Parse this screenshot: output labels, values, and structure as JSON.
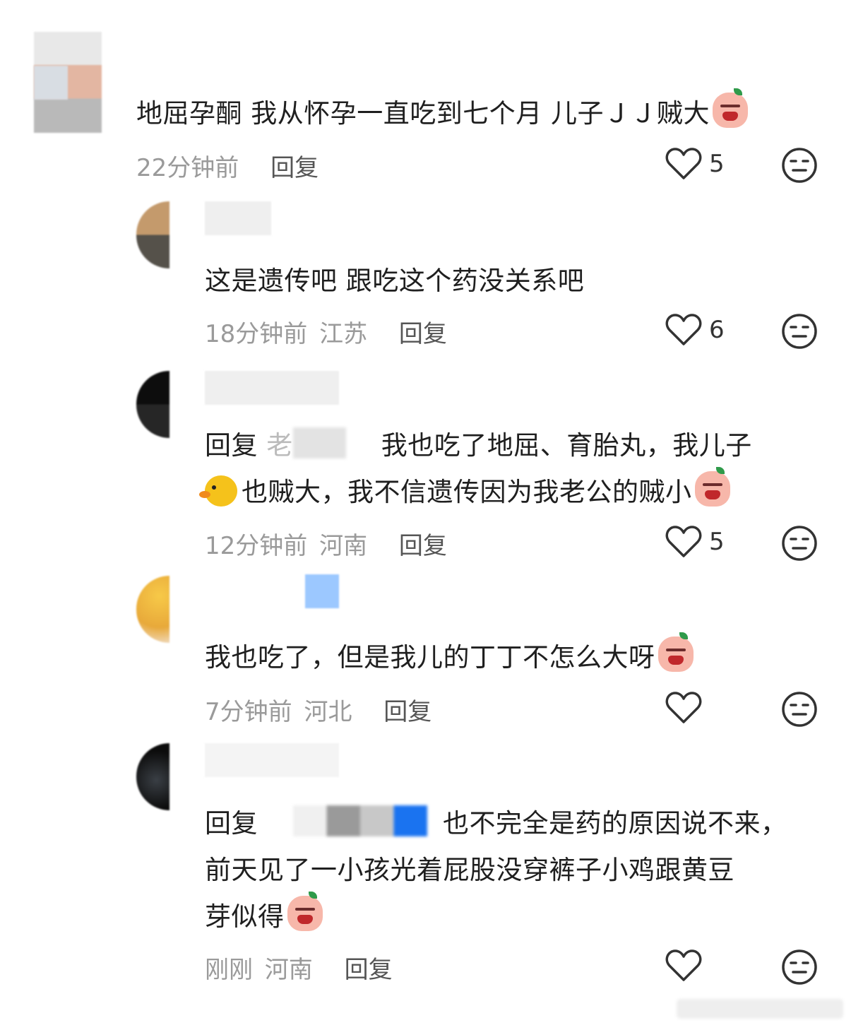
{
  "comments": [
    {
      "text": "地屈孕酮 我从怀孕一直吃到七个月  儿子ＪＪ贼大",
      "time": "22分钟前",
      "location": "",
      "reply_label": "回复",
      "likes": "5"
    },
    {
      "text": "这是遗传吧 跟吃这个药没关系吧",
      "time": "18分钟前",
      "location": "江苏",
      "reply_label": "回复",
      "likes": "6"
    },
    {
      "prefix": "回复",
      "prefix_name": "老",
      "text_line1": "我也吃了地屈、育胎丸，我儿子",
      "text_line2": "也贼大，我不信遗传因为我老公的贼小",
      "time": "12分钟前",
      "location": "河南",
      "reply_label": "回复",
      "likes": "5"
    },
    {
      "text": "我也吃了，但是我儿的丁丁不怎么大呀",
      "time": "7分钟前",
      "location": "河北",
      "reply_label": "回复",
      "likes": ""
    },
    {
      "prefix": "回复",
      "text_line1": "也不完全是药的原因说不来，",
      "text_line2": "前天见了一小孩光着屁股没穿裤子小鸡跟黄豆",
      "text_line3": "芽似得",
      "time": "刚刚",
      "location": "河南",
      "reply_label": "回复",
      "likes": ""
    }
  ],
  "icons": {
    "like": "heart-outline-icon",
    "dislike": "neutral-face-icon",
    "emoji_crying": "crying-peach-emoji",
    "emoji_duck": "duck-emoji"
  },
  "colors": {
    "text": "#1f1f1f",
    "meta": "#9a9a9a",
    "icon": "#333333"
  }
}
